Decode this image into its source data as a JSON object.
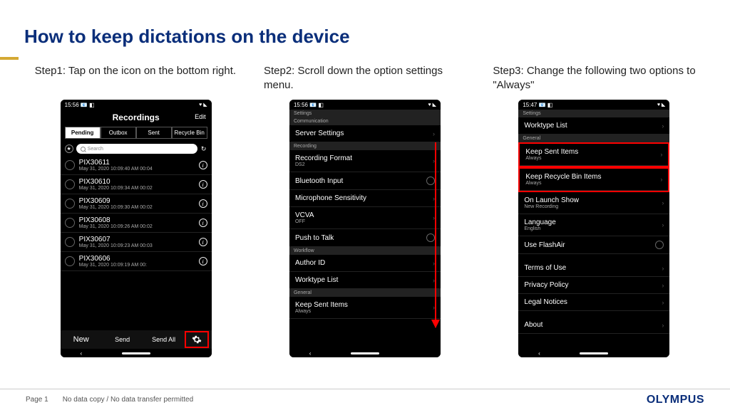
{
  "title": "How to keep dictations on the device",
  "steps": {
    "s1": "Step1: Tap on the icon on the bottom right.",
    "s2": "Step2: Scroll down the option settings menu.",
    "s3": "Step3: Change the following two options to \"Always\""
  },
  "phone1": {
    "time": "15:56  📧 ◧",
    "status_r": "♥ ◣",
    "screen_title": "Recordings",
    "edit": "Edit",
    "tabs": {
      "pending": "Pending",
      "outbox": "Outbox",
      "sent": "Sent",
      "bin": "Recycle Bin"
    },
    "search_placeholder": "Search",
    "items": [
      {
        "title": "PIX30611",
        "sub": "May 31, 2020 10:09:40 AM   00:04"
      },
      {
        "title": "PIX30610",
        "sub": "May 31, 2020 10:09:34 AM   00:02"
      },
      {
        "title": "PIX30609",
        "sub": "May 31, 2020 10:09:30 AM   00:02"
      },
      {
        "title": "PIX30608",
        "sub": "May 31, 2020 10:09:26 AM   00:02"
      },
      {
        "title": "PIX30607",
        "sub": "May 31, 2020 10:09:23 AM   00:03"
      },
      {
        "title": "PIX30606",
        "sub": "May 31, 2020 10:09:19 AM   00:"
      }
    ],
    "bottom": {
      "new": "New",
      "send": "Send",
      "sendall": "Send All"
    }
  },
  "phone2": {
    "time": "15:56  📧 ◧",
    "status_r": "♥ ◣",
    "header": "Settings",
    "sections": {
      "communication": "Communication",
      "recording": "Recording",
      "workflow": "Workflow",
      "general": "General"
    },
    "rows": {
      "server": "Server Settings",
      "format": "Recording Format",
      "format_sub": "DS2",
      "bt": "Bluetooth Input",
      "mic": "Microphone Sensitivity",
      "vcva": "VCVA",
      "vcva_sub": "OFF",
      "ptt": "Push to Talk",
      "author": "Author ID",
      "worktype": "Worktype List",
      "keep_sent": "Keep Sent Items",
      "keep_sent_sub": "Always"
    }
  },
  "phone3": {
    "time": "15:47  📧 ◧",
    "status_r": "♥ ◣",
    "header": "Settings",
    "rows": {
      "worktype": "Worktype List",
      "general": "General",
      "keep_sent": "Keep Sent Items",
      "keep_sent_sub": "Always",
      "keep_bin": "Keep Recycle Bin Items",
      "keep_bin_sub": "Always",
      "launch": "On Launch Show",
      "launch_sub": "New Recording",
      "lang": "Language",
      "lang_sub": "English",
      "flash": "Use FlashAir",
      "terms": "Terms of Use",
      "privacy": "Privacy Policy",
      "legal": "Legal Notices",
      "about": "About"
    }
  },
  "footer": {
    "page": "Page 1",
    "notice": "No data copy / No data transfer permitted",
    "logo": "OLYMPUS"
  }
}
